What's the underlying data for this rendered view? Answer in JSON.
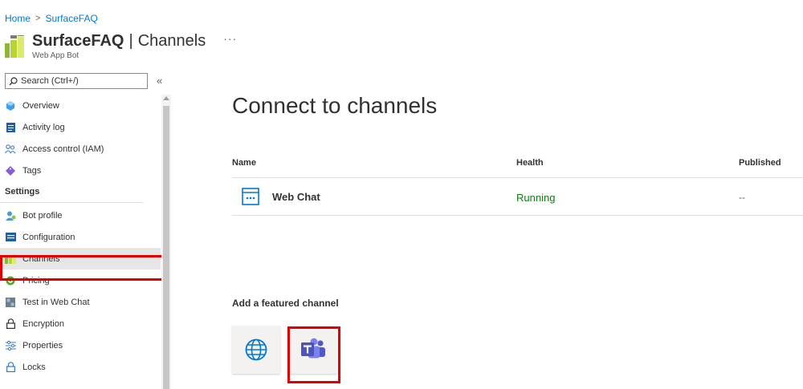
{
  "breadcrumb": {
    "home": "Home",
    "separator": ">",
    "current": "SurfaceFAQ"
  },
  "header": {
    "resource_name": "SurfaceFAQ",
    "separator": "|",
    "page_name": "Channels",
    "more": "···",
    "subtitle": "Web App Bot"
  },
  "search": {
    "placeholder": "Search (Ctrl+/)",
    "collapse": "«"
  },
  "sidebar": {
    "items": [
      {
        "label": "Overview",
        "icon": "overview-icon"
      },
      {
        "label": "Activity log",
        "icon": "activity-log-icon"
      },
      {
        "label": "Access control (IAM)",
        "icon": "iam-icon"
      },
      {
        "label": "Tags",
        "icon": "tag-icon"
      }
    ],
    "settings_header": "Settings",
    "settings_items": [
      {
        "label": "Bot profile",
        "icon": "bot-profile-icon"
      },
      {
        "label": "Configuration",
        "icon": "configuration-icon"
      },
      {
        "label": "Channels",
        "icon": "channels-icon",
        "active": true
      },
      {
        "label": "Pricing",
        "icon": "pricing-icon"
      },
      {
        "label": "Test in Web Chat",
        "icon": "test-web-chat-icon"
      },
      {
        "label": "Encryption",
        "icon": "lock-icon"
      },
      {
        "label": "Properties",
        "icon": "properties-icon"
      },
      {
        "label": "Locks",
        "icon": "lock-icon"
      }
    ]
  },
  "main": {
    "title": "Connect to channels",
    "table": {
      "headers": {
        "name": "Name",
        "health": "Health",
        "published": "Published"
      },
      "rows": [
        {
          "name": "Web Chat",
          "health": "Running",
          "published": "--",
          "icon": "web-chat-icon"
        }
      ]
    },
    "featured": {
      "label": "Add a featured channel",
      "channels": [
        {
          "icon": "globe-icon"
        },
        {
          "icon": "teams-icon"
        }
      ]
    }
  },
  "colors": {
    "accent": "#0078d4",
    "running": "#107c10",
    "highlight": "#e00000",
    "teams": "#5059c9"
  }
}
